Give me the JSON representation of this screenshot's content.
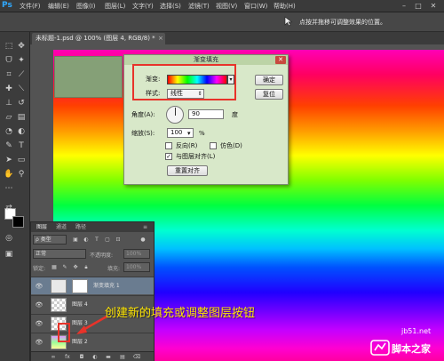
{
  "app": {
    "logo": "Ps",
    "menu": [
      "文件(F)",
      "编辑(E)",
      "图像(I)",
      "图层(L)",
      "文字(Y)",
      "选择(S)",
      "滤镜(T)",
      "视图(V)",
      "窗口(W)",
      "帮助(H)"
    ],
    "window_controls": {
      "minimize": "–",
      "maximize": "□",
      "close": "✕"
    }
  },
  "options_bar": {
    "hint": "点按并拖移可调整效果的位置。"
  },
  "document": {
    "tab_title": "未标题-1.psd @ 100% (图层 4, RGB/8) *",
    "tab_close": "×"
  },
  "dialog": {
    "title": "渐变填充",
    "close": "✕",
    "gradient_label": "渐变:",
    "style_label": "样式:",
    "style_value": "线性",
    "angle_label": "角度(A):",
    "angle_value": "90",
    "angle_unit": "度",
    "scale_label": "缩放(S):",
    "scale_value": "100",
    "scale_unit": "%",
    "reverse_label": "反向(R)",
    "dither_label": "仿色(D)",
    "align_label": "与图层对齐(L)",
    "align_checked": "✓",
    "reset_align_button": "重置对齐",
    "ok_button": "确定",
    "cancel_button": "复位"
  },
  "layers_panel": {
    "tabs": [
      "图层",
      "通道",
      "路径"
    ],
    "filter_label": "ρ 类型",
    "blend_mode": "正常",
    "opacity_label": "不透明度:",
    "opacity_value": "100%",
    "lock_label": "锁定:",
    "fill_label": "填充:",
    "fill_value": "100%",
    "layers": [
      {
        "name": "渐变填充 1",
        "visible": true
      },
      {
        "name": "图层 4",
        "visible": true
      },
      {
        "name": "图层 3",
        "visible": true
      },
      {
        "name": "图层 2",
        "visible": true
      }
    ],
    "footer_icons": [
      "link-icon",
      "fx-icon",
      "mask-icon",
      "adjustment-icon",
      "folder-icon",
      "new-layer-icon",
      "trash-icon"
    ]
  },
  "annotation": {
    "text": "创建新的填充或调整图层按钮"
  },
  "watermark": {
    "url": "jb51.net",
    "name": "脚本之家"
  },
  "colors": {
    "highlight_red": "#e8332a",
    "annotation_yellow": "#ffe600"
  }
}
